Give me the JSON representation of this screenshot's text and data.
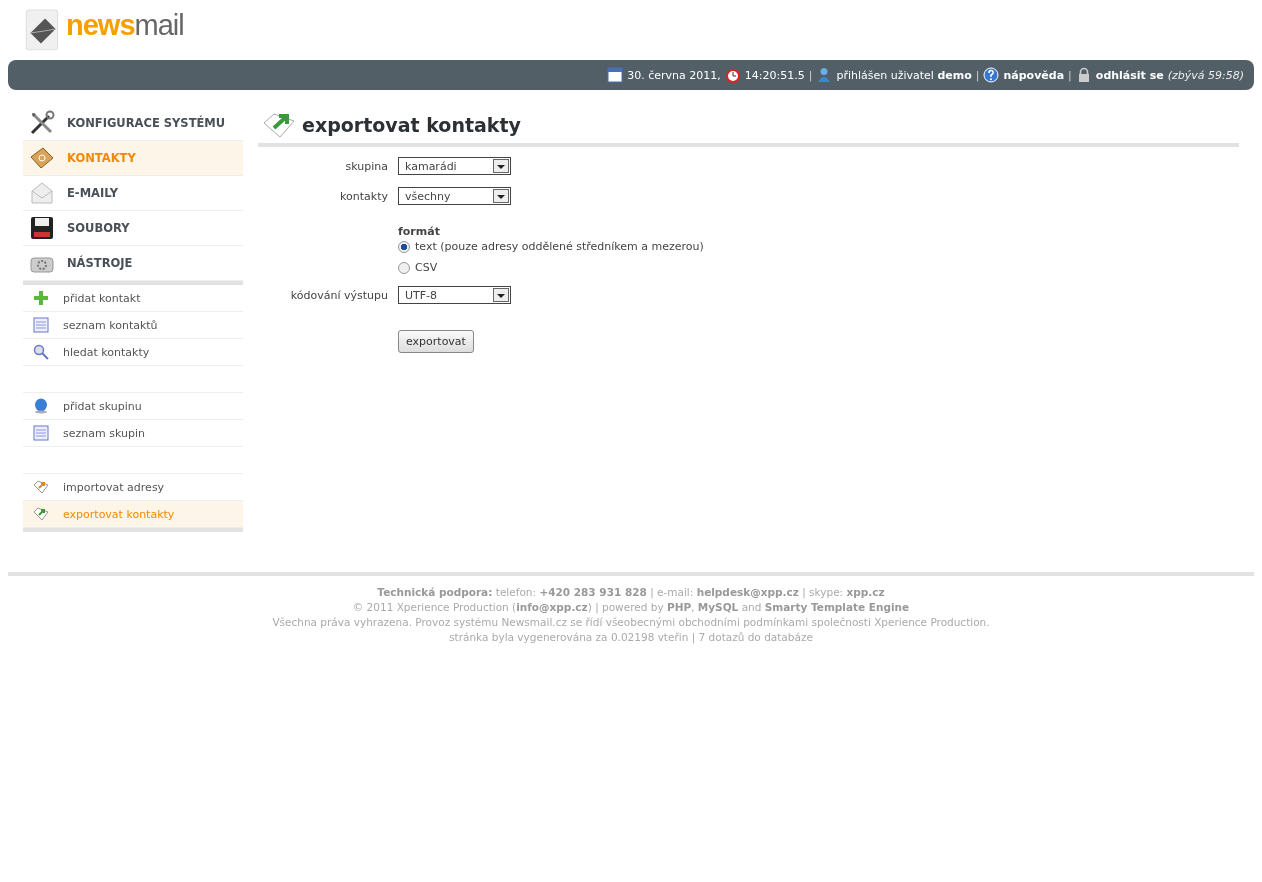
{
  "logo": {
    "part_1": "news",
    "part_2": "mail"
  },
  "top_bar": {
    "items": [
      {
        "kind": "date",
        "text": "30. června 2011,"
      },
      {
        "kind": "time",
        "text": "14:20:51.5"
      },
      {
        "kind": "separator",
        "text": "|"
      },
      {
        "kind": "user",
        "text": "přihlášen uživatel **demo**"
      },
      {
        "kind": "separator",
        "text": "|"
      },
      {
        "kind": "help",
        "text": "**nápověda**"
      },
      {
        "kind": "separator",
        "text": "|"
      },
      {
        "kind": "logout",
        "text": "**odhlásit se**",
        "note": "*(zbývá 59:58)*"
      }
    ]
  },
  "sidebar": {
    "main_items": [
      {
        "kind": "tools",
        "label": "KONFIGURACE SYSTÉMU",
        "selected": false
      },
      {
        "kind": "book",
        "label": "KONTAKTY",
        "selected": true
      },
      {
        "kind": "envelope",
        "label": "E-MAILY",
        "selected": false
      },
      {
        "kind": "floppy",
        "label": "SOUBORY",
        "selected": false
      },
      {
        "kind": "gear",
        "label": "NÁSTROJE",
        "selected": false
      }
    ],
    "groups": [
      {
        "items": [
          {
            "kind": "plus",
            "label": "přidat kontakt",
            "selected": false
          },
          {
            "kind": "list",
            "label": "seznam kontaktů",
            "selected": false
          },
          {
            "kind": "search",
            "label": "hledat kontakty",
            "selected": false
          }
        ]
      },
      {
        "items": [
          {
            "kind": "globe",
            "label": "přidat skupinu",
            "selected": false
          },
          {
            "kind": "list",
            "label": "seznam skupin",
            "selected": false
          }
        ]
      },
      {
        "items": [
          {
            "kind": "import",
            "label": "importovat adresy",
            "selected": false
          },
          {
            "kind": "export",
            "label": "exportovat kontakty",
            "selected": true
          }
        ]
      }
    ]
  },
  "content": {
    "title": "exportovat kontakty",
    "fields": [
      {
        "kind": "select",
        "label": "skupina",
        "value": "kamarádi"
      },
      {
        "kind": "select",
        "label": "kontakty",
        "value": "všechny"
      },
      {
        "kind": "radio_group",
        "label": "formát",
        "options": [
          {
            "label": "text (pouze adresy oddělené středníkem a mezerou)",
            "selected": true
          },
          {
            "label": "CSV",
            "selected": false
          }
        ]
      },
      {
        "kind": "select",
        "label": "kódování výstupu",
        "value": "UTF-8"
      }
    ],
    "submit": "exportovat"
  },
  "footer": {
    "lines": [
      "**Technická podpora:** telefon: **+420 283 931 828** | e-mail: **helpdesk@xpp.cz** | skype: **xpp.cz**",
      "© 2011 Xperience Production (**info@xpp.cz**) | powered by **PHP**, **MySQL** and **Smarty Template Engine**",
      "Všechna práva vyhrazena. Provoz systému Newsmail.cz se řídí všeobecnými obchodními podmínkami společnosti Xperience Production.",
      "stránka byla vygenerována za 0.02198 vteřin | 7 dotazů do databáze"
    ]
  }
}
